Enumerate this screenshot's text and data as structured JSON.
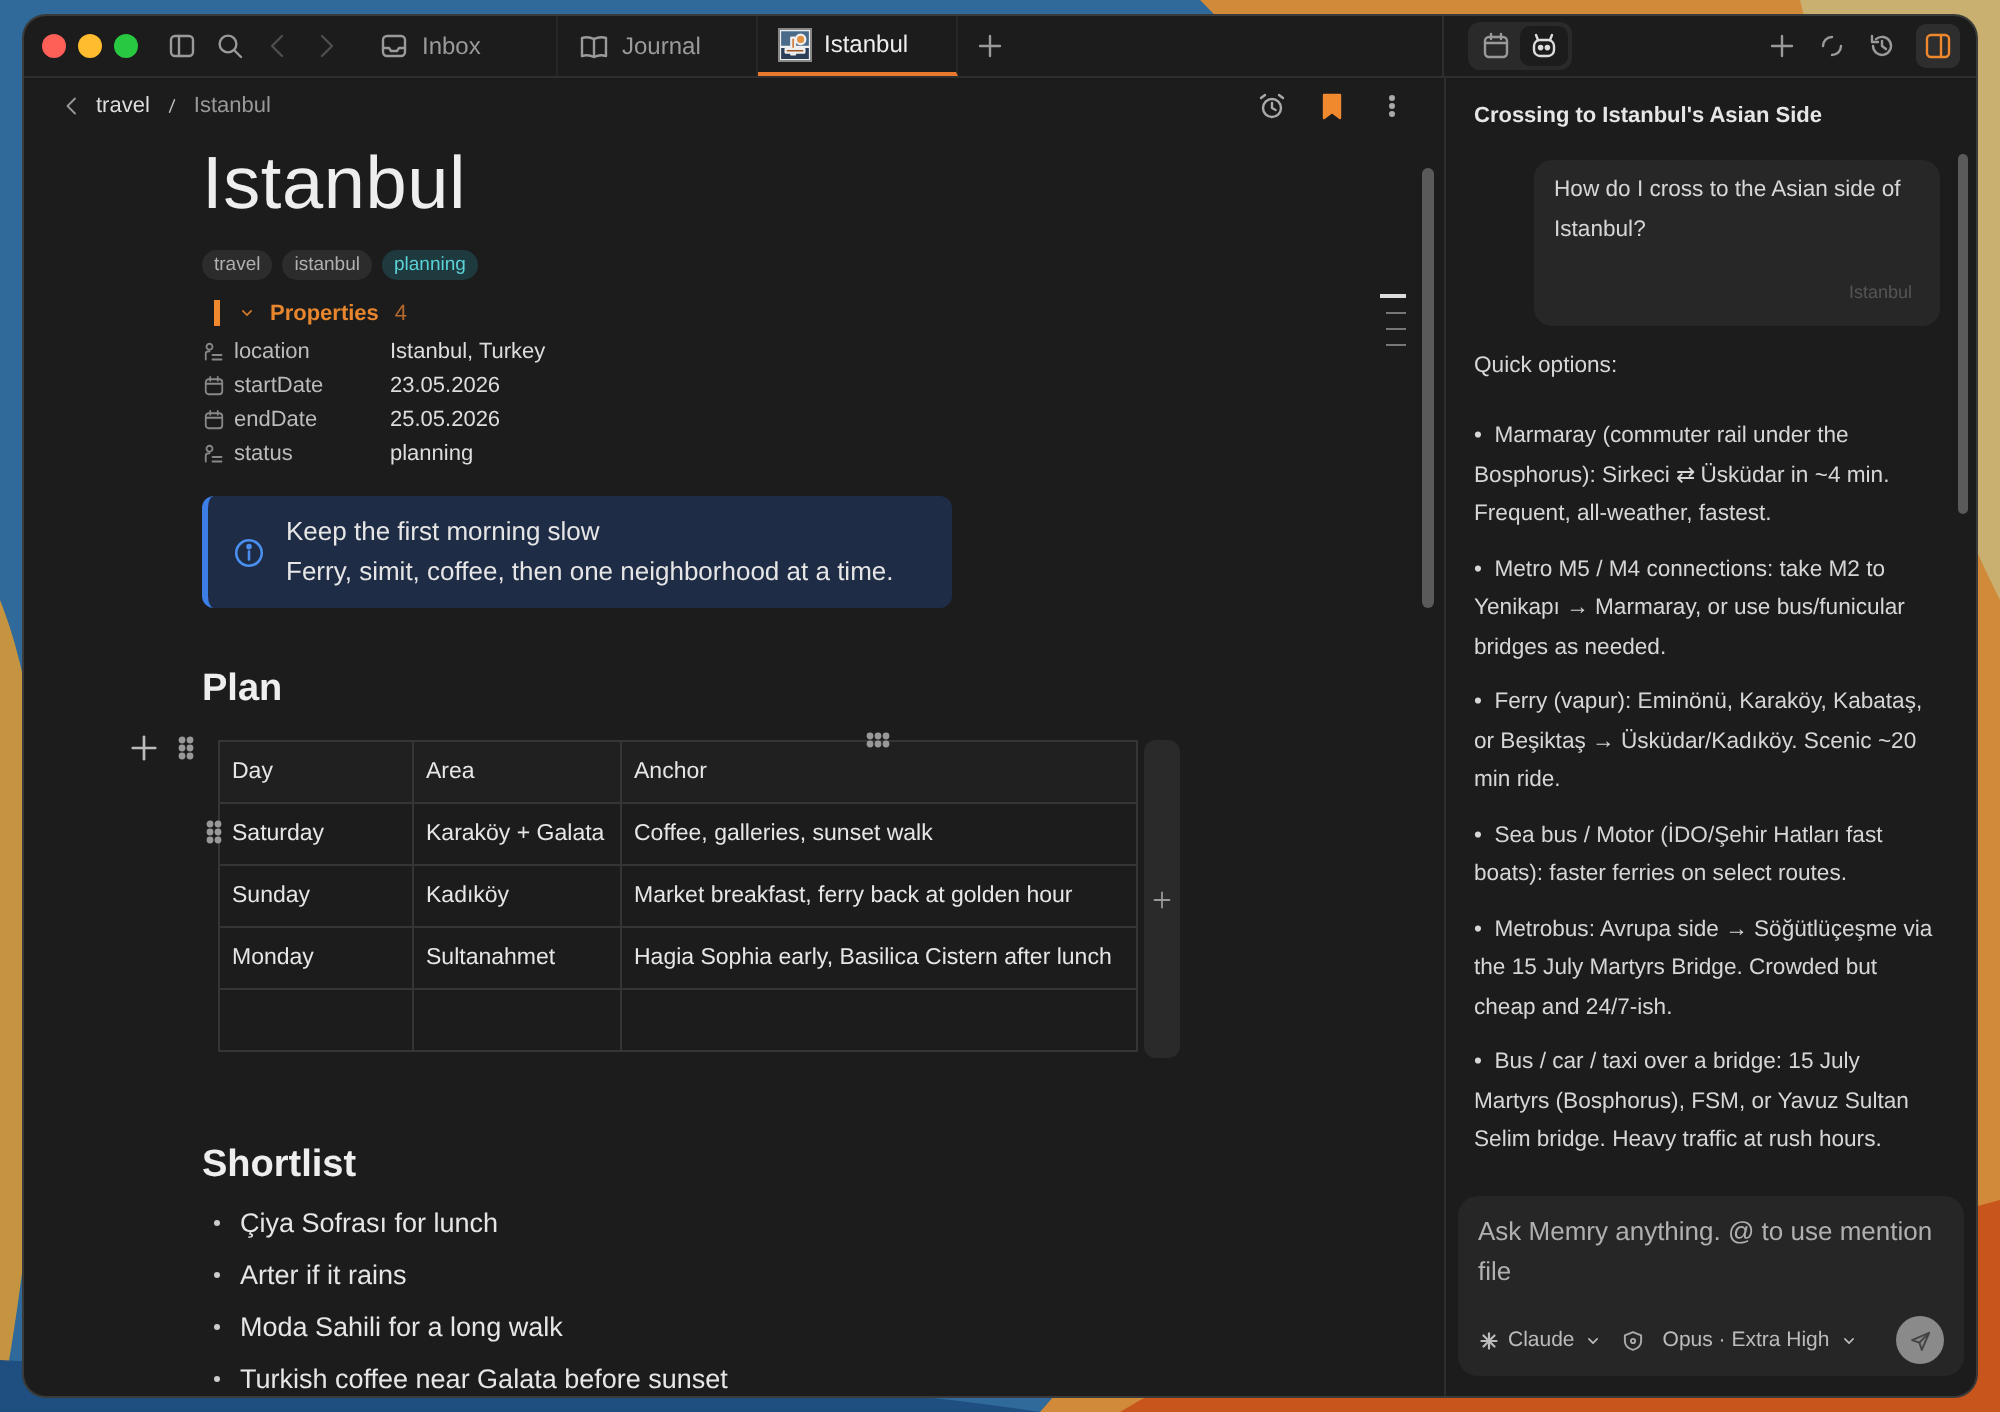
{
  "tabs": [
    {
      "label": "Inbox",
      "selected": false
    },
    {
      "label": "Journal",
      "selected": false
    },
    {
      "label": "Istanbul",
      "selected": true
    }
  ],
  "breadcrumb": [
    "travel",
    "Istanbul"
  ],
  "note_actions": {
    "bookmarked": true
  },
  "note": {
    "title": "Istanbul",
    "tags": [
      {
        "label": "travel",
        "highlighted": false
      },
      {
        "label": "istanbul",
        "highlighted": false
      },
      {
        "label": "planning",
        "highlighted": true
      }
    ],
    "properties": {
      "label": "Properties",
      "count": "4",
      "expanded": true,
      "items": [
        {
          "kind": "text",
          "name": "location",
          "value": "Istanbul, Turkey"
        },
        {
          "kind": "date",
          "name": "startDate",
          "value": "23.05.2026"
        },
        {
          "kind": "date",
          "name": "endDate",
          "value": "25.05.2026"
        },
        {
          "kind": "text",
          "name": "status",
          "value": "planning"
        }
      ]
    },
    "callout": {
      "title": "Keep the first morning slow",
      "text": "Ferry, simit, coffee, then one neighborhood at a time."
    },
    "plan": {
      "heading": "Plan",
      "columns": [
        "Day",
        "Area",
        "Anchor"
      ],
      "rows": [
        [
          "Saturday",
          "Karaköy + Galata",
          "Coffee, galleries, sunset walk"
        ],
        [
          "Sunday",
          "Kadıköy",
          "Market breakfast, ferry back at golden hour"
        ],
        [
          "Monday",
          "Sultanahmet",
          "Hagia Sophia early, Basilica Cistern after lunch"
        ]
      ]
    },
    "shortlist": {
      "heading": "Shortlist",
      "items": [
        "Çiya Sofrası for lunch",
        "Arter if it rains",
        "Moda Sahili for a long walk",
        "Turkish coffee near Galata before sunset"
      ]
    }
  },
  "assistant": {
    "modes": [
      {
        "selected": false
      },
      {
        "selected": true
      }
    ],
    "panel_open": true,
    "title": "Crossing to Istanbul's Asian Side",
    "question": "How do I cross to the Asian side of Istanbul?",
    "context_chip": "Istanbul",
    "intro": "Quick options:",
    "options": [
      "•  Marmaray (commuter rail under the Bosphorus): Sirkeci ⇄ Üsküdar in ~4 min. Frequent, all-weather, fastest.",
      "•  Metro M5 / M4 connections: take M2 to Yenikapı → Marmaray, or use bus/funicular bridges as needed.",
      "•  Ferry (vapur): Eminönü, Karaköy, Kabataş, or Beşiktaş → Üsküdar/Kadıköy. Scenic ~20 min ride.",
      "•  Sea bus / Motor (İDO/Şehir Hatları fast boats): faster ferries on select routes.",
      "•  Metrobus: Avrupa side → Söğütlüçeşme via the 15 July Martyrs Bridge. Crowded but cheap and 24/7-ish.",
      "•  Bus / car / taxi over a bridge: 15 July Martyrs (Bosphorus), FSM, or Yavuz Sultan Selim bridge. Heavy traffic at rush hours."
    ],
    "input": {
      "placeholder": "Ask Memry anything. @ to use mention file"
    },
    "provider": "Claude",
    "model": "Opus · Extra High"
  }
}
